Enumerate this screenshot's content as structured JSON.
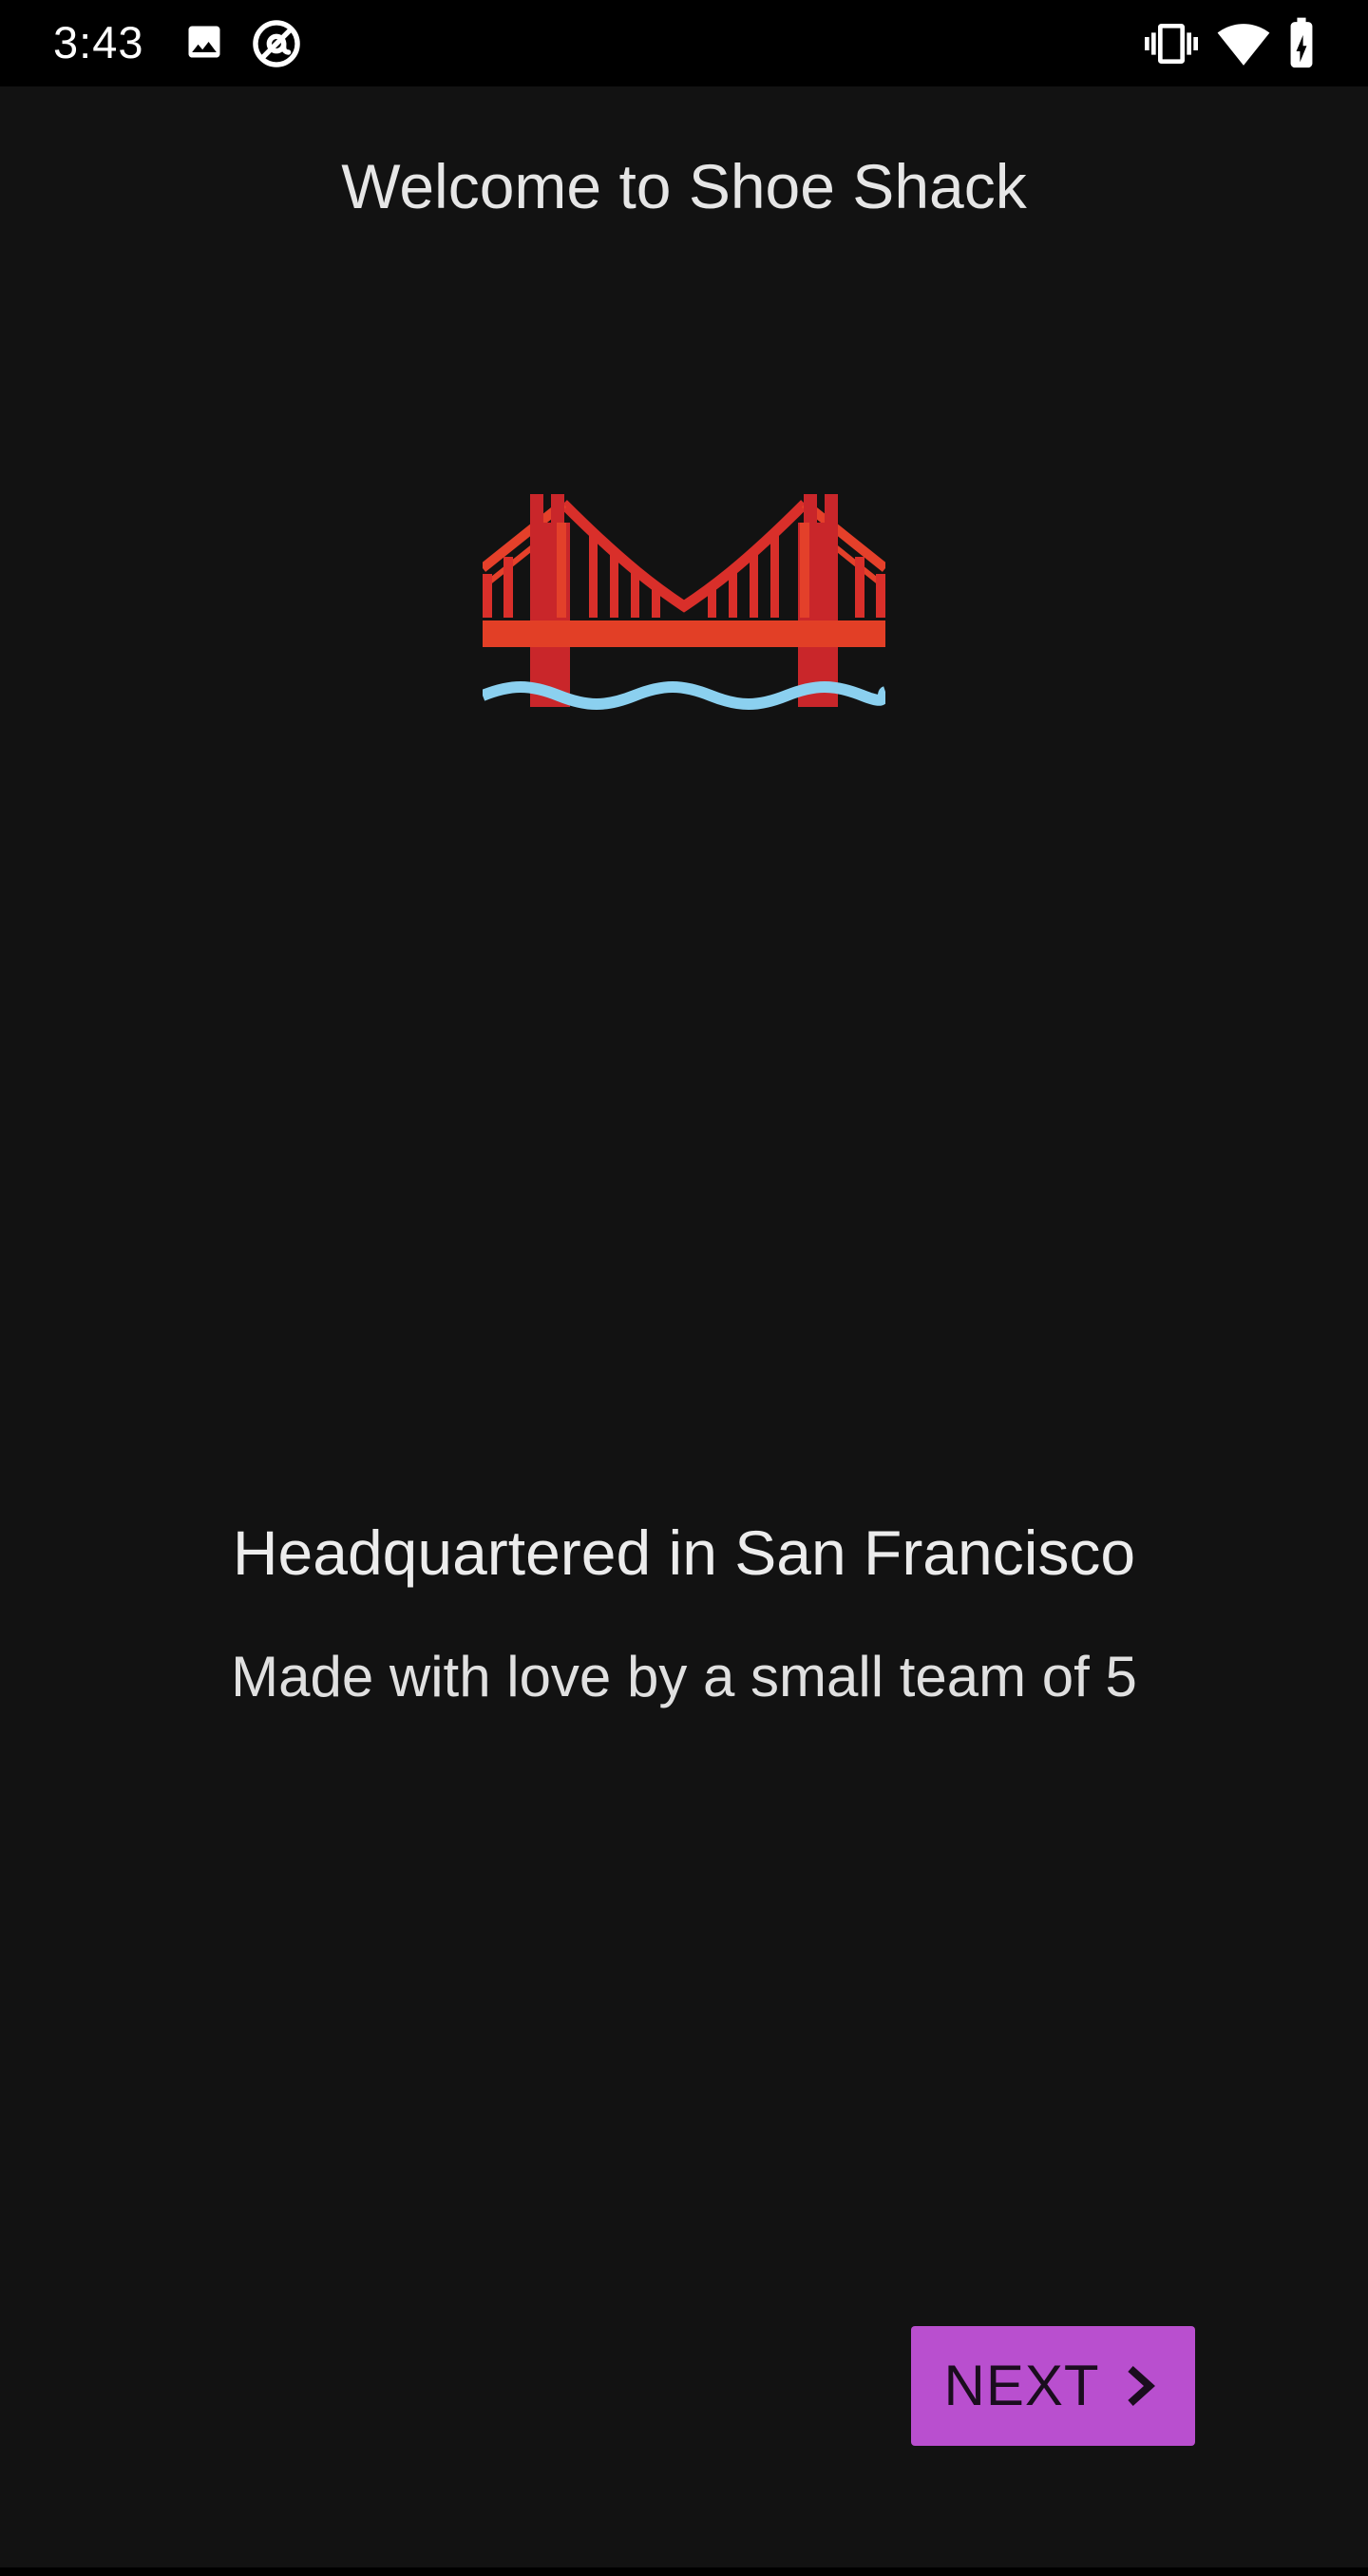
{
  "status_bar": {
    "time": "3:43",
    "icons": [
      "image-icon",
      "at-icon",
      "vibrate-icon",
      "wifi-icon",
      "battery-charging-icon"
    ]
  },
  "header": {
    "title": "Welcome to Shoe Shack"
  },
  "illustration": {
    "icon": "golden-gate-bridge-icon",
    "colors": {
      "bridge": "#e0321e",
      "bridge_shadow": "#c4282b",
      "water": "#8bd0ef"
    }
  },
  "content": {
    "headline": "Headquartered in San Francisco",
    "subtext": "Made with love by a small team of 5"
  },
  "actions": {
    "next_label": "NEXT",
    "next_icon": "chevron-right-icon"
  },
  "colors": {
    "background": "#121212",
    "status_bar": "#000000",
    "accent": "#b94fcf",
    "text": "#e6e6e6"
  }
}
